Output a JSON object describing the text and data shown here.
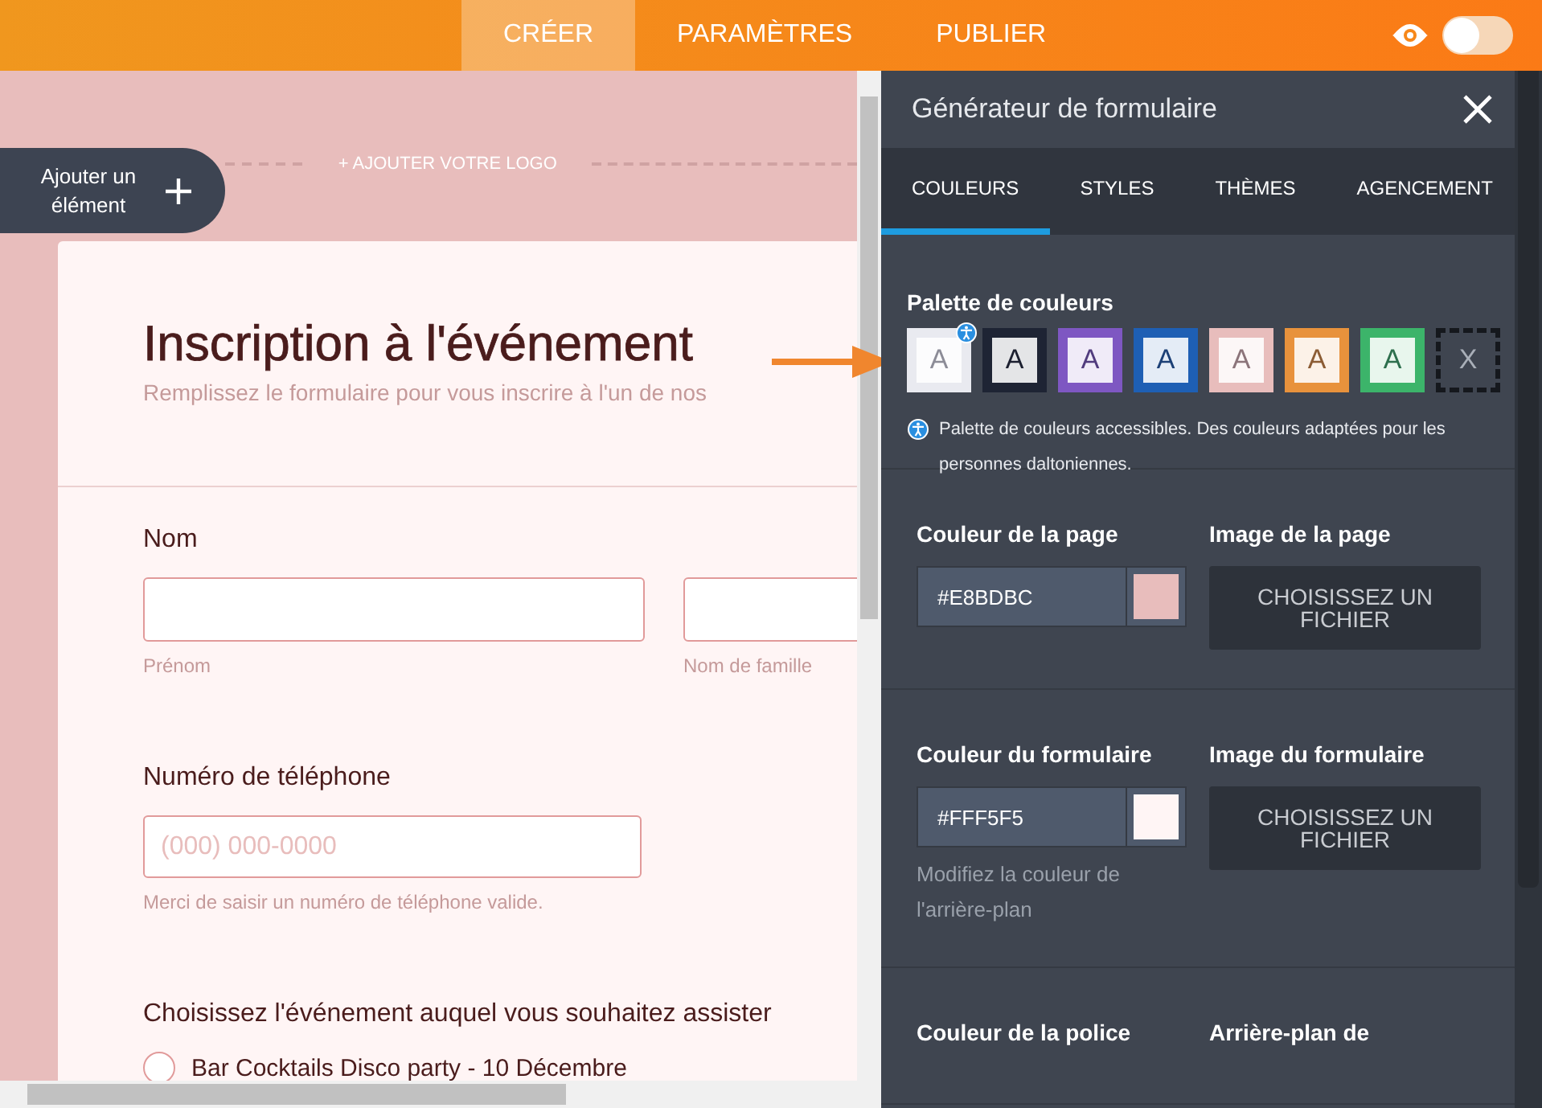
{
  "top_nav": {
    "tabs": [
      {
        "label": "CRÉER",
        "selected": true
      },
      {
        "label": "PARAMÈTRES",
        "selected": false
      },
      {
        "label": "PUBLIER",
        "selected": false
      }
    ],
    "preview_toggle": {
      "on": false
    }
  },
  "canvas": {
    "add_element_button": "Ajouter un élément",
    "logo_placeholder": "+ AJOUTER VOTRE LOGO",
    "form": {
      "title": "Inscription à l'événement",
      "subtitle": "Remplissez le formulaire pour vous inscrire à l'un de nos",
      "fields": [
        {
          "kind": "name",
          "label": "Nom",
          "sublabels": [
            "Prénom",
            "Nom de famille"
          ]
        },
        {
          "kind": "phone",
          "label": "Numéro de téléphone",
          "placeholder": "(000) 000-0000",
          "hint": "Merci de saisir un numéro de téléphone valide."
        },
        {
          "kind": "radio",
          "label": "Choisissez l'événement auquel vous souhaitez assister",
          "options": [
            {
              "label": "Bar Cocktails Disco party - 10 Décembre",
              "selected": false
            }
          ]
        }
      ]
    }
  },
  "panel": {
    "title": "Générateur de formulaire",
    "tabs": [
      {
        "label": "COULEURS",
        "selected": true
      },
      {
        "label": "STYLES",
        "selected": false
      },
      {
        "label": "THÈMES",
        "selected": false
      },
      {
        "label": "AGENCEMENT",
        "selected": false
      }
    ],
    "palette": {
      "heading": "Palette de couleurs",
      "swatches": [
        {
          "kind": "swatch",
          "label": "A",
          "color": "#e9eaf0",
          "accessible": true
        },
        {
          "kind": "swatch",
          "label": "A",
          "color": "#1e2434",
          "accessible": false
        },
        {
          "kind": "swatch",
          "label": "A",
          "color": "#7e57c2",
          "accessible": false
        },
        {
          "kind": "swatch",
          "label": "A",
          "color": "#1e5fb4",
          "accessible": false
        },
        {
          "kind": "swatch",
          "label": "A",
          "color": "#e8bdbc",
          "accessible": false
        },
        {
          "kind": "swatch",
          "label": "A",
          "color": "#e8923c",
          "accessible": false
        },
        {
          "kind": "swatch",
          "label": "A",
          "color": "#3cb46a",
          "accessible": false
        },
        {
          "kind": "none",
          "label": "X",
          "accessible": false
        }
      ],
      "note": "Palette de couleurs accessibles. Des couleurs adaptées pour les personnes daltoniennes."
    },
    "sections": [
      {
        "color_label": "Couleur de la page",
        "color_value": "#E8BDBC",
        "color": "#e8bdbc",
        "image_label": "Image de la page",
        "image_button": "CHOISISSEZ UN FICHIER"
      },
      {
        "color_label": "Couleur du formulaire",
        "color_value": "#FFF5F5",
        "color": "#fff5f5",
        "hint": "Modifiez la couleur de l'arrière-plan",
        "image_label": "Image du formulaire",
        "image_button": "CHOISISSEZ UN FICHIER"
      },
      {
        "color_label": "Couleur de la police",
        "image_label": "Arrière-plan de"
      }
    ]
  }
}
